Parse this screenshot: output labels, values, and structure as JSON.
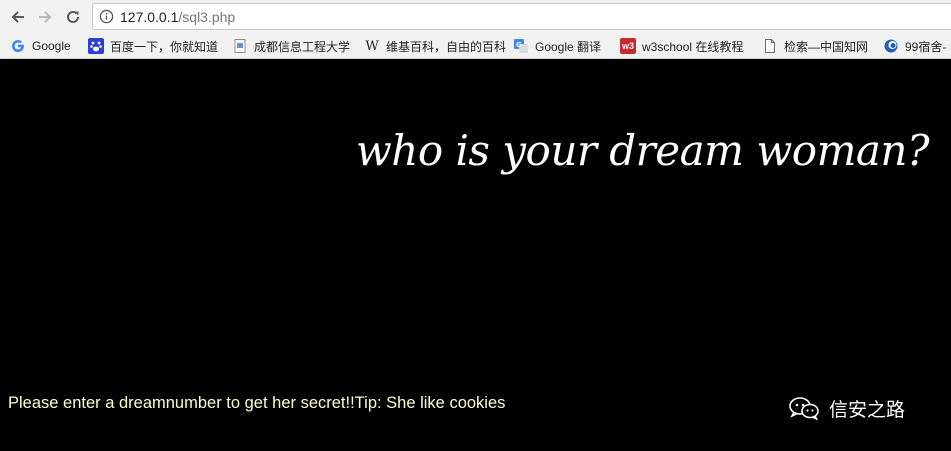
{
  "browser": {
    "url_host": "127.0.0.1",
    "url_path": "/sql3.php"
  },
  "bookmarks": [
    {
      "label": "Google",
      "icon": "google-icon"
    },
    {
      "label": "百度一下，你就知道",
      "icon": "baidu-paw-icon"
    },
    {
      "label": "成都信息工程大学",
      "icon": "page-icon"
    },
    {
      "label": "维基百科，自由的百科",
      "icon": "wikipedia-icon"
    },
    {
      "label": "Google 翻译",
      "icon": "google-translate-icon"
    },
    {
      "label": "w3school 在线教程",
      "icon": "w3school-icon"
    },
    {
      "label": "检索—中国知网",
      "icon": "document-icon"
    },
    {
      "label": "99宿舍-",
      "icon": "globe-icon"
    }
  ],
  "page": {
    "heading": "who is your dream woman?",
    "tip": "Please enter a dreamnumber to get her secret!!Tip: She like cookies",
    "watermark": "信安之路"
  },
  "colors": {
    "page_bg": "#000000",
    "heading": "#ffffff",
    "tip": "#ffffc9",
    "toolbar_bg": "#f2f2f2"
  }
}
